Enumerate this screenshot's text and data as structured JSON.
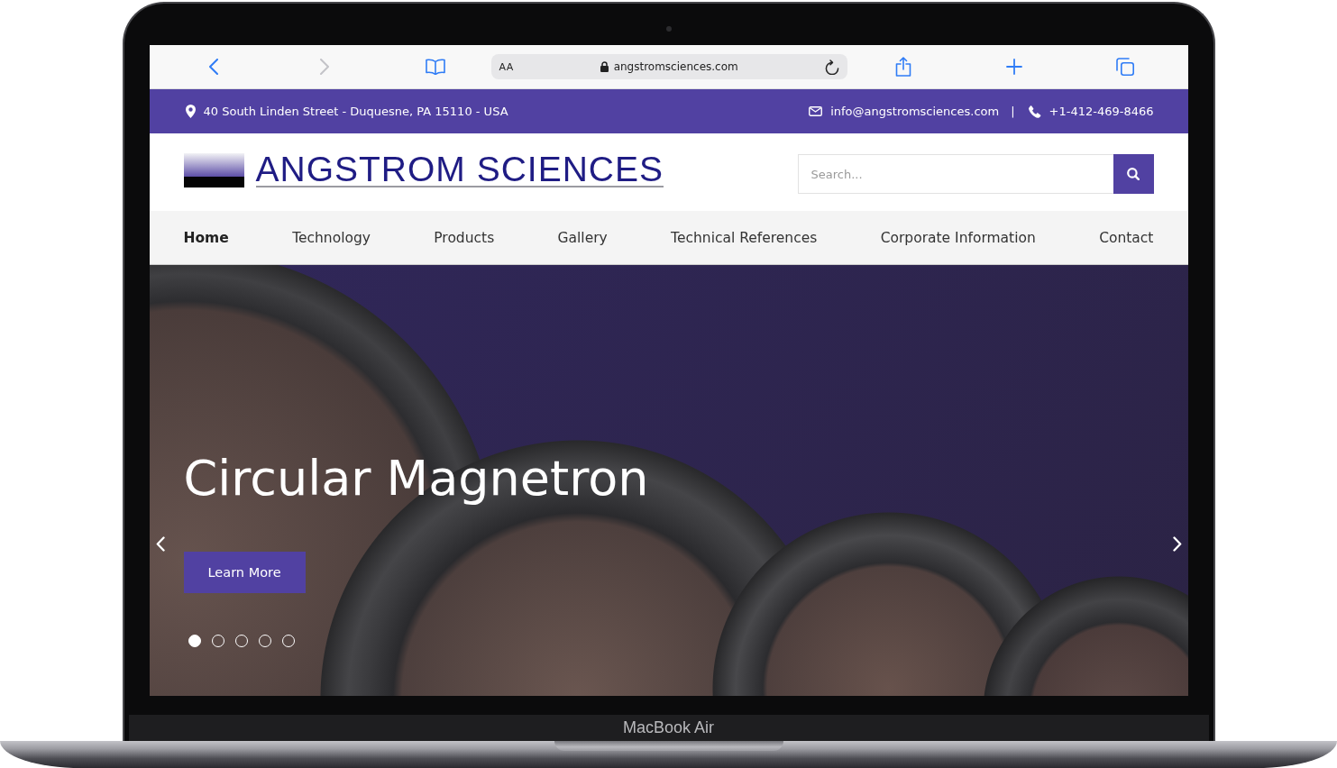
{
  "browser": {
    "toolbar_left": [
      {
        "kind": "back",
        "disabled": false
      },
      {
        "kind": "forward",
        "disabled": true
      },
      {
        "kind": "bookmarks",
        "disabled": false
      }
    ],
    "reader_label": "AA",
    "url": "angstromsciences.com",
    "toolbar_right": [
      {
        "kind": "share",
        "disabled": false
      },
      {
        "kind": "new_tab",
        "disabled": false
      },
      {
        "kind": "tabs",
        "disabled": false
      }
    ]
  },
  "top_bar": {
    "address": "40 South Linden Street - Duquesne, PA 15110 - USA",
    "email": "info@angstromsciences.com",
    "separator": "|",
    "phone": "+1-412-469-8466"
  },
  "header": {
    "logo_text": "ANGSTROM SCIENCES",
    "search": {
      "placeholder": "Search..."
    }
  },
  "nav": [
    {
      "label": "Home",
      "selected": true
    },
    {
      "label": "Technology",
      "selected": false
    },
    {
      "label": "Products",
      "selected": false
    },
    {
      "label": "Gallery",
      "selected": false
    },
    {
      "label": "Technical References",
      "selected": false
    },
    {
      "label": "Corporate Information",
      "selected": false
    },
    {
      "label": "Contact",
      "selected": false
    }
  ],
  "hero": {
    "title": "Circular Magnetron",
    "button": "Learn More",
    "slides": [
      {
        "selected": true
      },
      {
        "selected": false
      },
      {
        "selected": false
      },
      {
        "selected": false
      },
      {
        "selected": false
      }
    ]
  },
  "device": {
    "label": "MacBook Air"
  }
}
